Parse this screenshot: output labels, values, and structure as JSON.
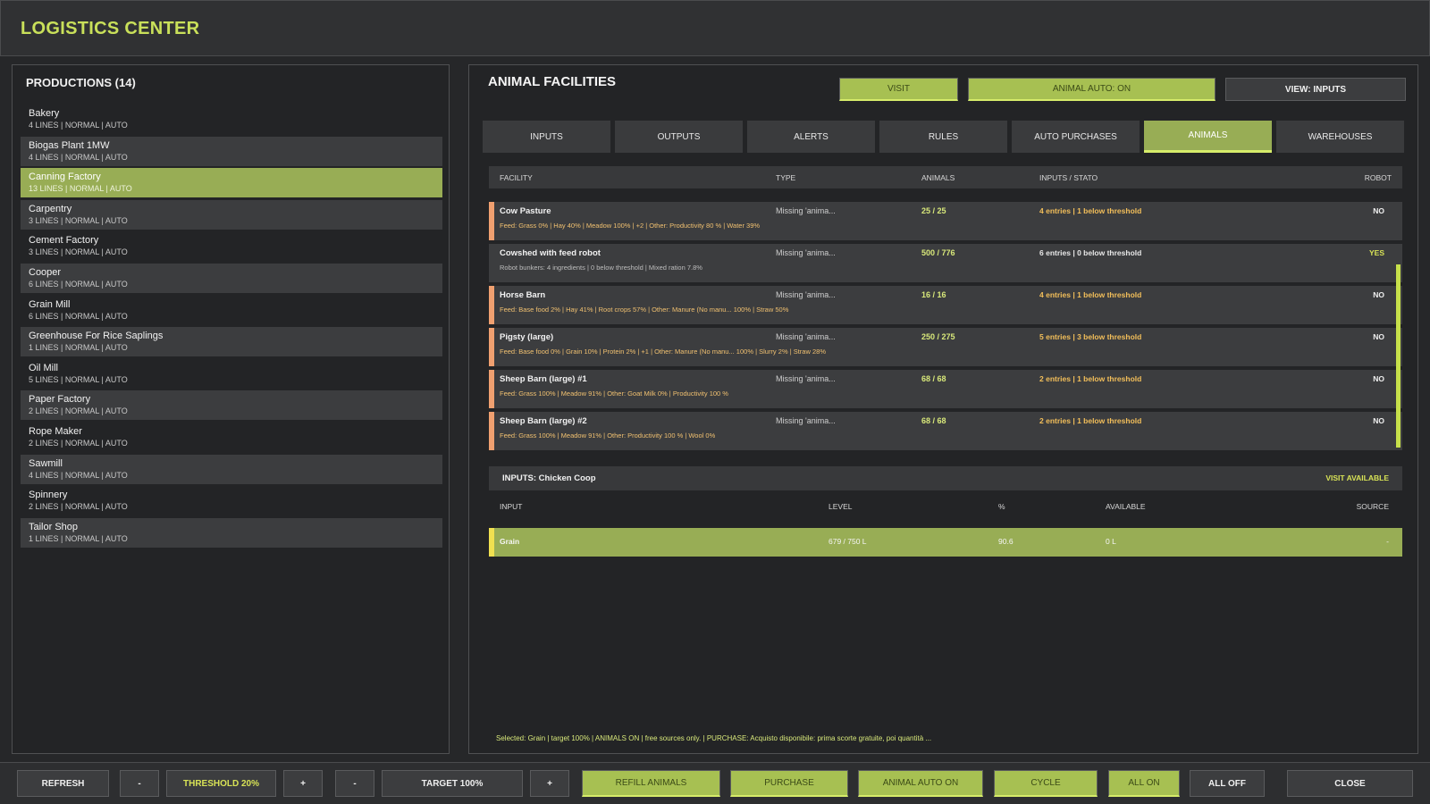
{
  "app": {
    "title": "LOGISTICS CENTER"
  },
  "productions": {
    "title": "PRODUCTIONS (14)",
    "items": [
      {
        "name": "Bakery",
        "sub": "4 LINES | NORMAL | AUTO"
      },
      {
        "name": "Biogas Plant 1MW",
        "sub": "4 LINES | NORMAL | AUTO"
      },
      {
        "name": "Canning Factory",
        "sub": "13 LINES | NORMAL | AUTO"
      },
      {
        "name": "Carpentry",
        "sub": "3 LINES | NORMAL | AUTO"
      },
      {
        "name": "Cement Factory",
        "sub": "3 LINES | NORMAL | AUTO"
      },
      {
        "name": "Cooper",
        "sub": "6 LINES | NORMAL | AUTO"
      },
      {
        "name": "Grain Mill",
        "sub": "6 LINES | NORMAL | AUTO"
      },
      {
        "name": "Greenhouse For Rice Saplings",
        "sub": "1 LINES | NORMAL | AUTO"
      },
      {
        "name": "Oil Mill",
        "sub": "5 LINES | NORMAL | AUTO"
      },
      {
        "name": "Paper Factory",
        "sub": "2 LINES | NORMAL | AUTO"
      },
      {
        "name": "Rope Maker",
        "sub": "2 LINES | NORMAL | AUTO"
      },
      {
        "name": "Sawmill",
        "sub": "4 LINES | NORMAL | AUTO"
      },
      {
        "name": "Spinnery",
        "sub": "2 LINES | NORMAL | AUTO"
      },
      {
        "name": "Tailor Shop",
        "sub": "1 LINES | NORMAL | AUTO"
      }
    ]
  },
  "facilities": {
    "title": "ANIMAL FACILITIES",
    "header_buttons": {
      "visit": "VISIT",
      "animal_auto": "ANIMAL AUTO: ON",
      "view": "VIEW: INPUTS"
    },
    "tabs": [
      "INPUTS",
      "OUTPUTS",
      "ALERTS",
      "RULES",
      "AUTO PURCHASES",
      "ANIMALS",
      "WAREHOUSES"
    ],
    "columns": {
      "facility": "FACILITY",
      "type": "TYPE",
      "animals": "ANIMALS",
      "inputs": "INPUTS / STATO",
      "robot": "ROBOT"
    },
    "rows": [
      {
        "name": "Cow Pasture",
        "type": "Missing 'anima...",
        "animals": "25 / 25",
        "inputs": "4 entries | 1 below threshold",
        "robot": "NO",
        "detail": "Feed: Grass 0% | Hay 40% | Meadow 100% | +2 | Other: Productivity 80 % | Water 39%"
      },
      {
        "name": "Cowshed with feed robot",
        "type": "Missing 'anima...",
        "animals": "500 / 776",
        "inputs": "6 entries | 0 below threshold",
        "robot": "YES",
        "detail": "Robot bunkers: 4 ingredients | 0 below threshold | Mixed ration 7.8%"
      },
      {
        "name": "Horse Barn",
        "type": "Missing 'anima...",
        "animals": "16 / 16",
        "inputs": "4 entries | 1 below threshold",
        "robot": "NO",
        "detail": "Feed: Base food 2% | Hay 41% | Root crops 57% | Other: Manure (No manu... 100% | Straw 50%"
      },
      {
        "name": "Pigsty (large)",
        "type": "Missing 'anima...",
        "animals": "250 / 275",
        "inputs": "5 entries | 3 below threshold",
        "robot": "NO",
        "detail": "Feed: Base food 0% | Grain 10% | Protein 2% | +1 | Other: Manure (No manu... 100% | Slurry 2% | Straw 28%"
      },
      {
        "name": "Sheep Barn (large) #1",
        "type": "Missing 'anima...",
        "animals": "68 / 68",
        "inputs": "2 entries | 1 below threshold",
        "robot": "NO",
        "detail": "Feed: Grass 100% | Meadow 91% | Other: Goat Milk 0% | Productivity 100 %"
      },
      {
        "name": "Sheep Barn (large) #2",
        "type": "Missing 'anima...",
        "animals": "68 / 68",
        "inputs": "2 entries | 1 below threshold",
        "robot": "NO",
        "detail": "Feed: Grass 100% | Meadow 91% | Other: Productivity 100 % | Wool 0%"
      }
    ]
  },
  "inputs_section": {
    "title": "INPUTS: Chicken Coop",
    "visit_available": "VISIT AVAILABLE",
    "columns": {
      "input": "INPUT",
      "level": "LEVEL",
      "percent": "%",
      "available": "AVAILABLE",
      "source": "SOURCE"
    },
    "row": {
      "input": "Grain",
      "level": "679 / 750 L",
      "percent": "90.6",
      "available": "0 L",
      "source": "-"
    }
  },
  "status_note": "Selected: Grain | target 100% | ANIMALS ON | free sources only. | PURCHASE: Acquisto disponibile: prima scorte gratuite, poi quantità ...",
  "bottom": {
    "refresh": "REFRESH",
    "minus": "-",
    "threshold": "THRESHOLD 20%",
    "plus": "+",
    "target": "TARGET 100%",
    "refill": "REFILL ANIMALS",
    "purchase": "PURCHASE",
    "animal_auto_on": "ANIMAL AUTO ON",
    "cycle": "CYCLE",
    "all_on": "ALL ON",
    "all_off": "ALL OFF",
    "close": "CLOSE"
  },
  "colors": {
    "accent": "#c9e05a",
    "selected": "#98ad55",
    "warning": "#f0a070"
  }
}
